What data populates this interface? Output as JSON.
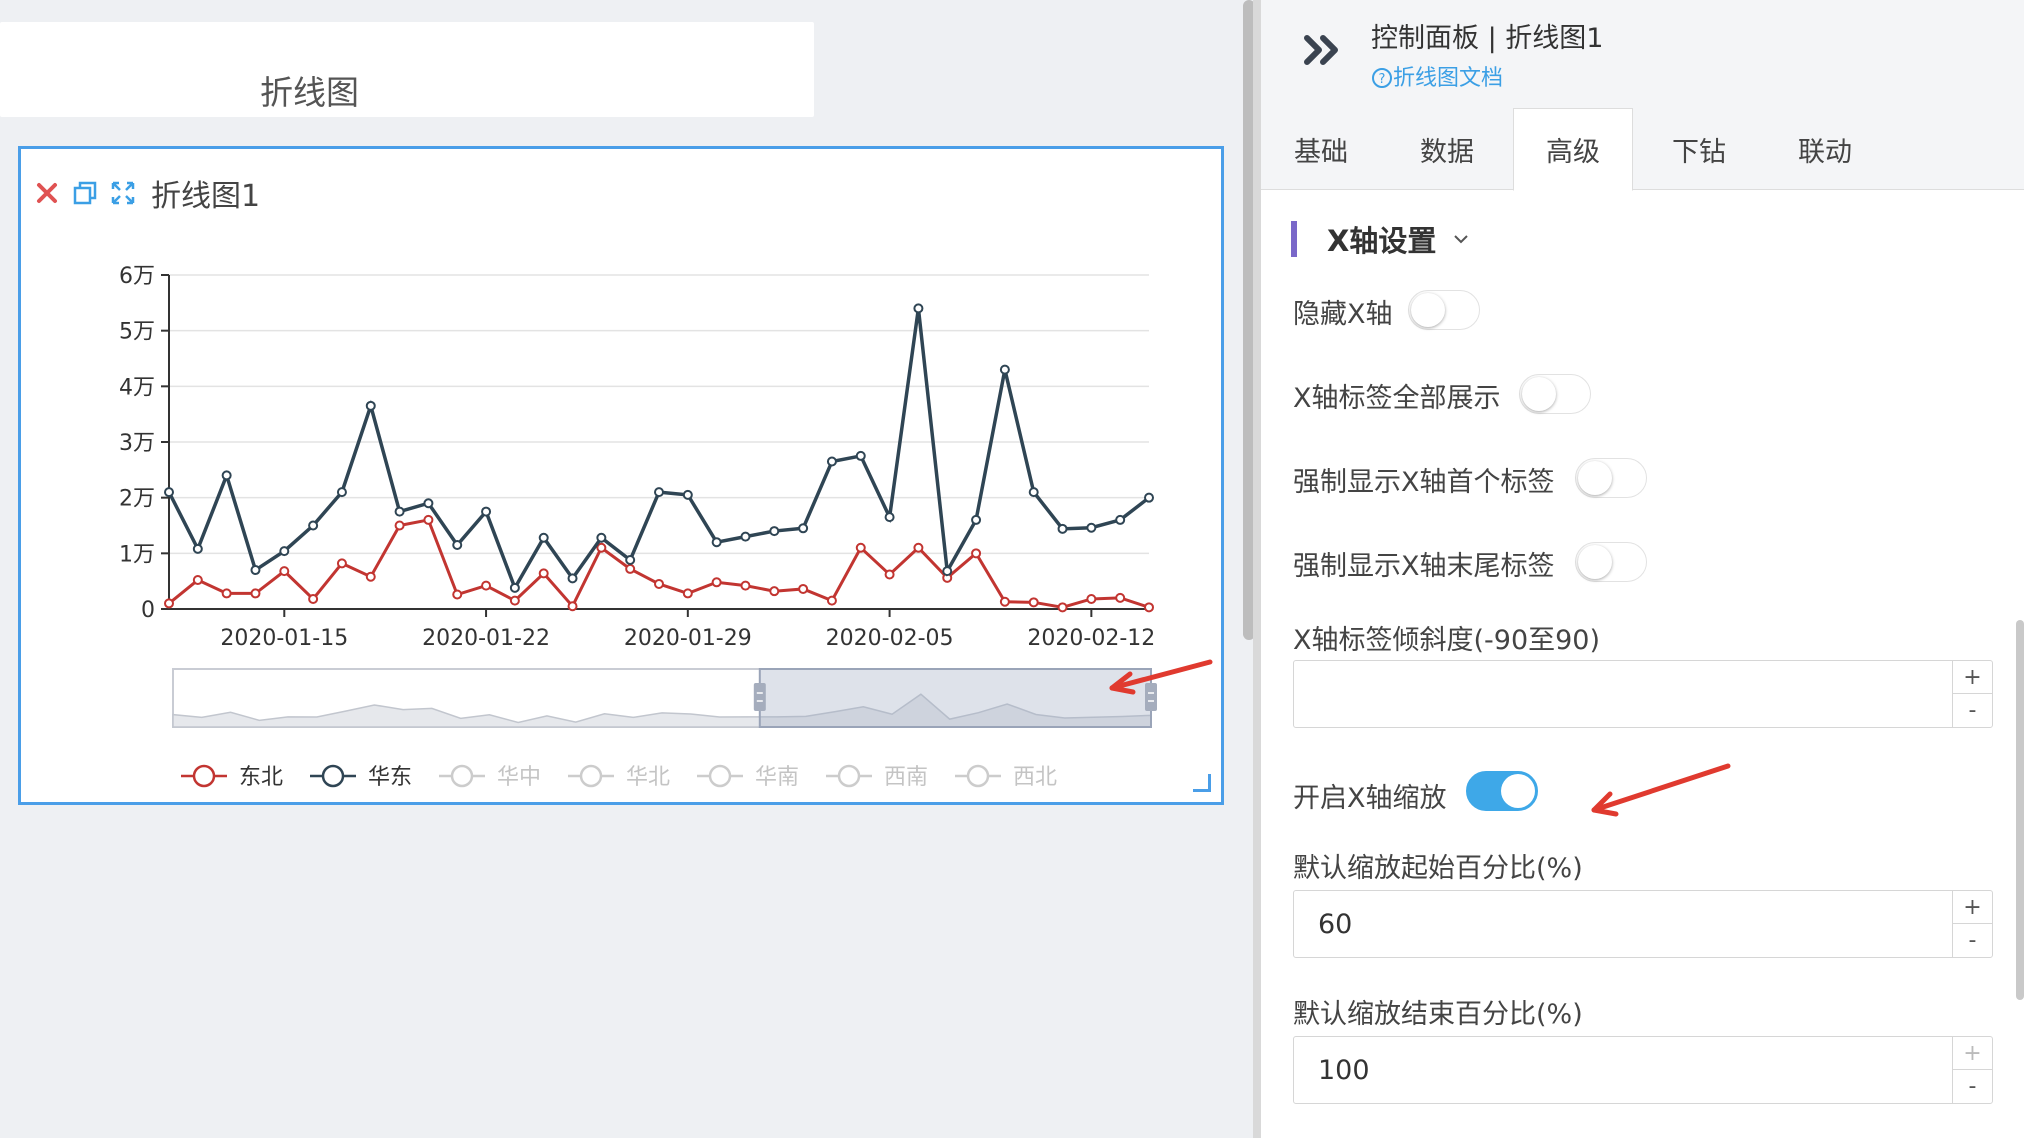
{
  "canvas": {
    "page_title": "折线图",
    "chart_title": "折线图1"
  },
  "panel": {
    "title": "控制面板 | 折线图1",
    "doc_link": "折线图文档",
    "tabs": [
      "基础",
      "数据",
      "高级",
      "下钻",
      "联动"
    ],
    "active_tab": "高级",
    "section_title": "X轴设置",
    "settings": {
      "hide_x_axis": {
        "label": "隐藏X轴",
        "on": false
      },
      "show_all_labels": {
        "label": "X轴标签全部展示",
        "on": false
      },
      "force_first_label": {
        "label": "强制显示X轴首个标签",
        "on": false
      },
      "force_last_label": {
        "label": "强制显示X轴末尾标签",
        "on": false
      },
      "label_rotate": {
        "label": "X轴标签倾斜度(-90至90)",
        "value": ""
      },
      "enable_zoom": {
        "label": "开启X轴缩放",
        "on": true
      },
      "zoom_start": {
        "label": "默认缩放起始百分比(%)",
        "value": "60"
      },
      "zoom_end": {
        "label": "默认缩放结束百分比(%)",
        "value": "100"
      }
    },
    "stepper_plus": "+",
    "stepper_minus": "-"
  },
  "colors": {
    "accent": "#3ea8e8",
    "card_border": "#4a9ee8",
    "series_dongbei": "#c23531",
    "series_huadong": "#2f4554",
    "annotation_arrow": "#e03a2f"
  },
  "icons": {
    "close": "close-icon",
    "copy": "copy-icon",
    "fullscreen": "expand-icon",
    "collapse": "double-chevron-right-icon",
    "help": "question-circle-icon"
  },
  "chart_data": {
    "type": "line",
    "y_ticks": [
      "0",
      "1万",
      "2万",
      "3万",
      "4万",
      "5万",
      "6万"
    ],
    "ylim": [
      0,
      60000
    ],
    "x_tick_labels": [
      "2020-01-15",
      "2020-01-22",
      "2020-01-29",
      "2020-02-05",
      "2020-02-12"
    ],
    "x_dates": [
      "2020-01-11",
      "2020-01-12",
      "2020-01-13",
      "2020-01-14",
      "2020-01-15",
      "2020-01-16",
      "2020-01-17",
      "2020-01-18",
      "2020-01-19",
      "2020-01-20",
      "2020-01-21",
      "2020-01-22",
      "2020-01-23",
      "2020-01-24",
      "2020-01-25",
      "2020-01-26",
      "2020-01-27",
      "2020-01-28",
      "2020-01-29",
      "2020-01-30",
      "2020-01-31",
      "2020-02-01",
      "2020-02-02",
      "2020-02-03",
      "2020-02-04",
      "2020-02-05",
      "2020-02-06",
      "2020-02-07",
      "2020-02-08",
      "2020-02-09",
      "2020-02-10",
      "2020-02-11",
      "2020-02-12",
      "2020-02-13",
      "2020-02-14"
    ],
    "series": [
      {
        "name": "东北",
        "values": [
          1000,
          5200,
          2800,
          2800,
          6800,
          1800,
          8200,
          5800,
          15000,
          16000,
          2600,
          4200,
          1500,
          6400,
          500,
          11000,
          7200,
          4500,
          2800,
          4800,
          4200,
          3200,
          3600,
          1500,
          11000,
          6200,
          11000,
          5600,
          10000,
          1300,
          1200,
          300,
          1800,
          2000,
          300
        ]
      },
      {
        "name": "华东",
        "values": [
          21000,
          10800,
          24000,
          7000,
          10400,
          15000,
          21000,
          36500,
          17500,
          19000,
          11500,
          17500,
          3800,
          12800,
          5500,
          12800,
          8800,
          21000,
          20500,
          12000,
          13000,
          14000,
          14500,
          26500,
          27500,
          16500,
          54000,
          6800,
          16000,
          43000,
          21000,
          14400,
          14600,
          16000,
          20000
        ]
      }
    ],
    "legend": [
      "东北",
      "华东",
      "华中",
      "华北",
      "华南",
      "西南",
      "西北"
    ],
    "legend_active": [
      "东北",
      "华东"
    ],
    "legend_placement": "bottom",
    "zoom": {
      "start": 60,
      "end": 100
    },
    "grid": true
  }
}
